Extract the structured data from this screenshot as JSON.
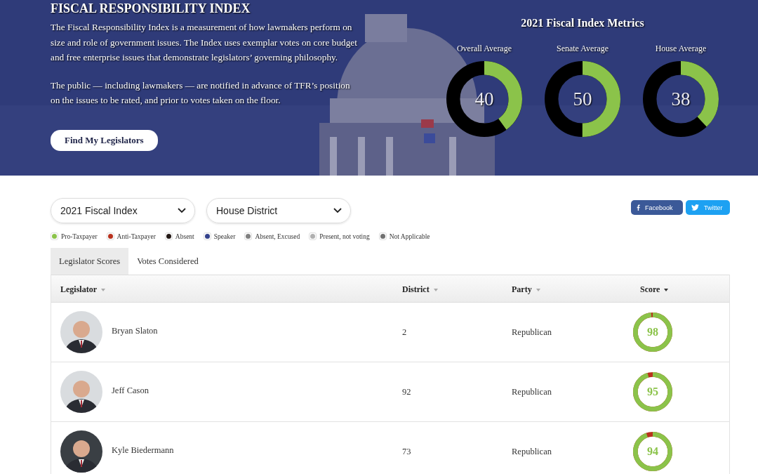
{
  "hero": {
    "title": "FISCAL RESPONSIBILITY INDEX",
    "paragraphs": [
      "The Fiscal Responsibility Index is a measurement of how lawmakers perform on size and role of government issues. The Index uses exemplar votes on core budget and free enterprise issues that demonstrate legislators’ governing philosophy.",
      "The public — including lawmakers — are notified in advance of TFR’s position on the issues to be rated, and prior to votes taken on the floor."
    ],
    "button": "Find My Legislators",
    "metrics_title": "2021 Fiscal Index Metrics",
    "metrics": [
      {
        "label": "Overall Average",
        "value": "40",
        "level": 0.4
      },
      {
        "label": "Senate Average",
        "value": "50",
        "level": 0.5
      },
      {
        "label": "House Average",
        "value": "38",
        "level": 0.38
      }
    ]
  },
  "filters": [
    {
      "value": "2021 Fiscal Index"
    },
    {
      "value": "House District"
    }
  ],
  "share": [
    {
      "kind": "facebook",
      "label": "Facebook"
    },
    {
      "kind": "twitter",
      "label": "Twitter"
    }
  ],
  "legend": [
    {
      "label": "Pro-Taxpayer",
      "color": "#8bc34a"
    },
    {
      "label": "Anti-Taxpayer",
      "color": "#b8321e"
    },
    {
      "label": "Absent",
      "color": "#231815"
    },
    {
      "label": "Speaker",
      "color": "#34428c"
    },
    {
      "label": "Absent, Excused",
      "color": "#808080"
    },
    {
      "label": "Present, not voting",
      "color": "#b0b0b0"
    },
    {
      "label": "Not Applicable",
      "color": "#707070"
    }
  ],
  "tabs": [
    {
      "label": "Legislator Scores",
      "selected": true
    },
    {
      "label": "Votes Considered",
      "selected": false
    }
  ],
  "table": {
    "columns": [
      {
        "label": "Legislator",
        "sorted": false
      },
      {
        "label": "District",
        "sorted": false
      },
      {
        "label": "Party",
        "sorted": false
      },
      {
        "label": "Score",
        "sorted": true
      }
    ],
    "rows": [
      {
        "name": "Bryan Slaton",
        "district": "2",
        "party": "Republican",
        "score": "98",
        "level": 0.98
      },
      {
        "name": "Jeff Cason",
        "district": "92",
        "party": "Republican",
        "score": "95",
        "level": 0.95
      },
      {
        "name": "Kyle Biedermann",
        "district": "73",
        "party": "Republican",
        "score": "94",
        "level": 0.94
      }
    ]
  }
}
